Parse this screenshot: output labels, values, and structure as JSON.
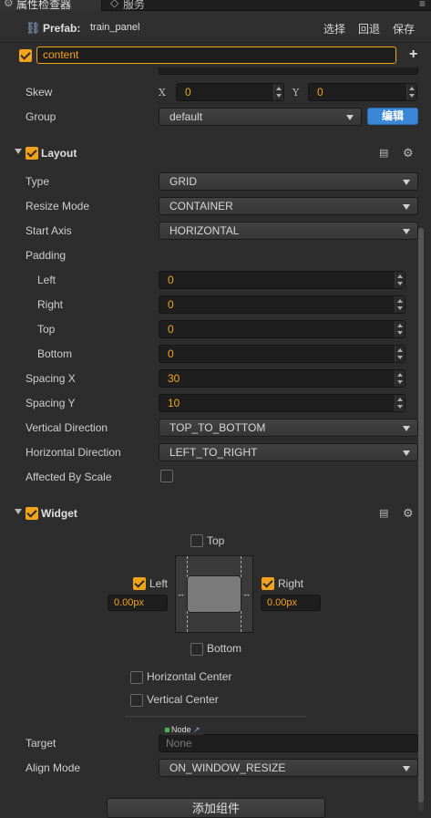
{
  "tabs": [
    {
      "label": "属性检查器",
      "icon": "gear-icon"
    },
    {
      "label": "服务",
      "icon": "service-icon"
    }
  ],
  "prefab": {
    "label": "Prefab:",
    "name": "train_panel",
    "actions": [
      "选择",
      "回退",
      "保存"
    ]
  },
  "node": {
    "name": "content",
    "active": true
  },
  "skew": {
    "label": "Skew",
    "x_label": "X",
    "x": "0",
    "y_label": "Y",
    "y": "0"
  },
  "group": {
    "label": "Group",
    "value": "default",
    "edit_label": "编辑"
  },
  "layout": {
    "title": "Layout",
    "enabled": true,
    "type": {
      "label": "Type",
      "value": "GRID"
    },
    "resize_mode": {
      "label": "Resize Mode",
      "value": "CONTAINER"
    },
    "start_axis": {
      "label": "Start Axis",
      "value": "HORIZONTAL"
    },
    "padding": {
      "label": "Padding",
      "left": {
        "label": "Left",
        "value": "0"
      },
      "right": {
        "label": "Right",
        "value": "0"
      },
      "top": {
        "label": "Top",
        "value": "0"
      },
      "bottom": {
        "label": "Bottom",
        "value": "0"
      }
    },
    "spacing_x": {
      "label": "Spacing X",
      "value": "30"
    },
    "spacing_y": {
      "label": "Spacing Y",
      "value": "10"
    },
    "vertical_direction": {
      "label": "Vertical Direction",
      "value": "TOP_TO_BOTTOM"
    },
    "horizontal_direction": {
      "label": "Horizontal Direction",
      "value": "LEFT_TO_RIGHT"
    },
    "affected_by_scale": {
      "label": "Affected By Scale",
      "checked": false
    }
  },
  "widget": {
    "title": "Widget",
    "enabled": true,
    "top": {
      "label": "Top",
      "checked": false
    },
    "left": {
      "label": "Left",
      "checked": true,
      "value": "0.00px"
    },
    "right": {
      "label": "Right",
      "checked": true,
      "value": "0.00px"
    },
    "bottom": {
      "label": "Bottom",
      "checked": false
    },
    "horizontal_center": {
      "label": "Horizontal Center",
      "checked": false
    },
    "vertical_center": {
      "label": "Vertical Center",
      "checked": false
    },
    "target": {
      "label": "Target",
      "tag": "Node",
      "placeholder": "None"
    },
    "align_mode": {
      "label": "Align Mode",
      "value": "ON_WINDOW_RESIZE"
    }
  },
  "add_component_label": "添加组件",
  "colors": {
    "accent": "#f3a21b",
    "button_blue": "#3a87d6"
  }
}
